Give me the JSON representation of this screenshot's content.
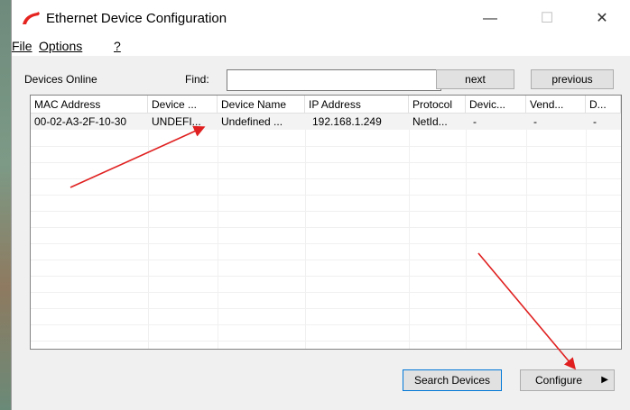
{
  "window": {
    "title": "Ethernet Device Configuration",
    "minimize": "—",
    "maximize": "☐",
    "close": "✕"
  },
  "menu": {
    "file": "File",
    "options": "Options",
    "help": "?"
  },
  "toolbar": {
    "devices_online_label": "Devices Online",
    "find_label": "Find:",
    "find_value": "",
    "next_label": "next",
    "previous_label": "previous"
  },
  "table": {
    "columns": [
      "MAC Address",
      "Device ...",
      "Device Name",
      "IP Address",
      "Protocol",
      "Devic...",
      "Vend...",
      "D..."
    ],
    "rows": [
      [
        "00-02-A3-2F-10-30",
        "UNDEFI...",
        "Undefined ...",
        "192.168.1.249",
        "NetId...",
        "-",
        "-",
        "-"
      ]
    ]
  },
  "bottom": {
    "search_label": "Search Devices",
    "configure_label": "Configure",
    "configure_arrow": "▶"
  },
  "colors": {
    "arrow": "#e02020",
    "icon_red": "#e52420"
  }
}
